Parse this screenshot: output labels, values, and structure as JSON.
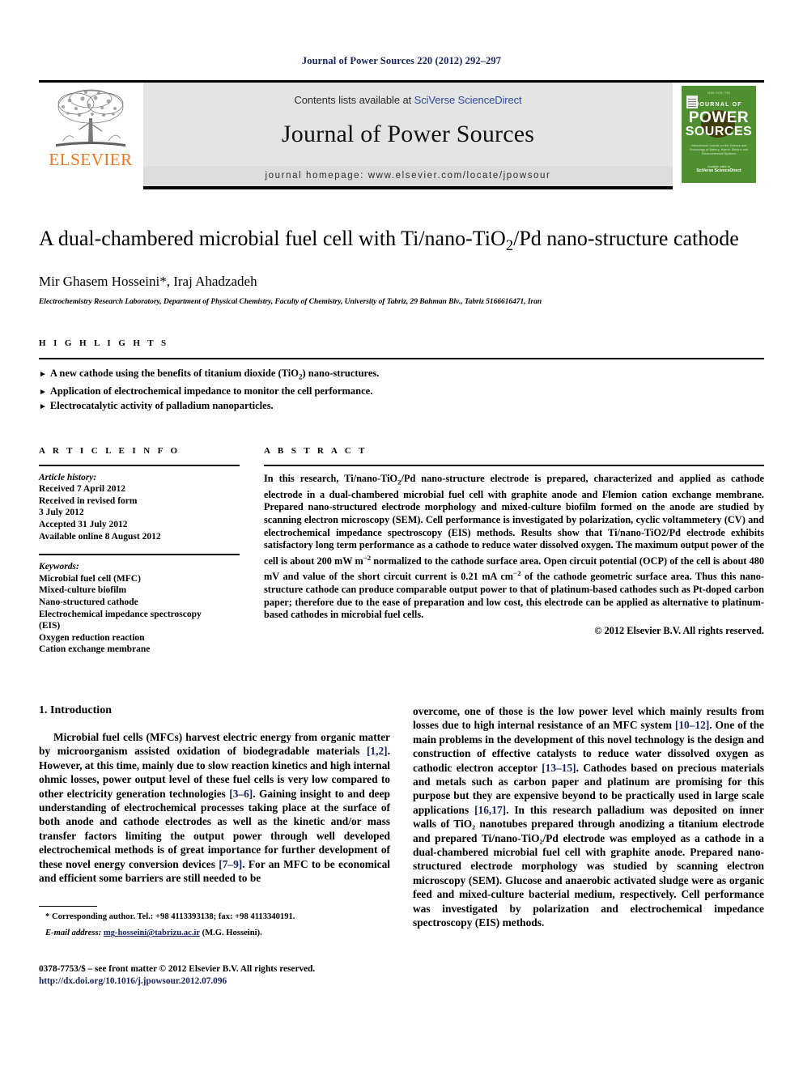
{
  "running_head": "Journal of Power Sources 220 (2012) 292–297",
  "masthead": {
    "publisher_name": "ELSEVIER",
    "contents_prefix": "Contents lists available at ",
    "contents_link": "SciVerse ScienceDirect",
    "journal_name": "Journal of Power Sources",
    "homepage": "journal homepage: www.elsevier.com/locate/jpowsour",
    "cover": {
      "topline": "ISSN 0378-7753",
      "journal_of": "JOURNAL OF",
      "power": "POWER",
      "sources": "SOURCES",
      "subtitle": "International Journal on the Science and Technology of Battery, Hybrid, Electric and Electrochemical Systems",
      "foot_small": "Available online at",
      "foot_big": "SciVerse ScienceDirect"
    }
  },
  "article": {
    "title": "A dual-chambered microbial fuel cell with Ti/nano-TiO₂/Pd nano-structure cathode",
    "authors": "Mir Ghasem Hosseini*, Iraj Ahadzadeh",
    "affiliation": "Electrochemistry Research Laboratory, Department of Physical Chemistry, Faculty of Chemistry, University of Tabriz, 29 Bahman Blv., Tabriz 5166616471, Iran"
  },
  "highlights": {
    "heading": "H I G H L I G H T S",
    "items": [
      "A new cathode using the benefits of titanium dioxide (TiO₂) nano-structures.",
      "Application of electrochemical impedance to monitor the cell performance.",
      "Electrocatalytic activity of palladium nanoparticles."
    ]
  },
  "article_info": {
    "heading": "A R T I C L E   I N F O",
    "history_label": "Article history:",
    "history": [
      "Received 7 April 2012",
      "Received in revised form",
      "3 July 2012",
      "Accepted 31 July 2012",
      "Available online 8 August 2012"
    ],
    "keywords_label": "Keywords:",
    "keywords": [
      "Microbial fuel cell (MFC)",
      "Mixed-culture biofilm",
      "Nano-structured cathode",
      "Electrochemical impedance spectroscopy",
      "(EIS)",
      "Oxygen reduction reaction",
      "Cation exchange membrane"
    ]
  },
  "abstract": {
    "heading": "A B S T R A C T",
    "text": "In this research, Ti/nano-TiO₂/Pd nano-structure electrode is prepared, characterized and applied as cathode electrode in a dual-chambered microbial fuel cell with graphite anode and Flemion cation exchange membrane. Prepared nano-structured electrode morphology and mixed-culture biofilm formed on the anode are studied by scanning electron microscopy (SEM). Cell performance is investigated by polarization, cyclic voltammetery (CV) and electrochemical impedance spectroscopy (EIS) methods. Results show that Ti/nano-TiO2/Pd electrode exhibits satisfactory long term performance as a cathode to reduce water dissolved oxygen. The maximum output power of the cell is about 200 mW m⁻² normalized to the cathode surface area. Open circuit potential (OCP) of the cell is about 480 mV and value of the short circuit current is 0.21 mA cm⁻² of the cathode geometric surface area. Thus this nano-structure cathode can produce comparable output power to that of platinum-based cathodes such as Pt-doped carbon paper; therefore due to the ease of preparation and low cost, this electrode can be applied as alternative to platinum-based cathodes in microbial fuel cells.",
    "copyright": "© 2012 Elsevier B.V. All rights reserved."
  },
  "introduction": {
    "heading": "1.  Introduction",
    "left_paragraph_part1": "Microbial fuel cells (MFCs) harvest electric energy from organic matter by microorganism assisted oxidation of biodegradable materials ",
    "left_ref1": "[1,2]",
    "left_paragraph_part2": ". However, at this time, mainly due to slow reaction kinetics and high internal ohmic losses, power output level of these fuel cells is very low compared to other electricity generation technologies ",
    "left_ref2": "[3–6]",
    "left_paragraph_part3": ". Gaining insight to and deep understanding of electrochemical processes taking place at the surface of both anode and cathode electrodes as well as the kinetic and/or mass transfer factors limiting the output power through well developed electrochemical methods is of great importance for further development of these novel energy conversion devices ",
    "left_ref3": "[7–9]",
    "left_paragraph_part4": ". For an MFC to be economical and efficient some barriers are still needed to be",
    "right_part1": "overcome, one of those is the low power level which mainly results from losses due to high internal resistance of an MFC system ",
    "right_ref1": "[10–12]",
    "right_part2": ". One of the main problems in the development of this novel technology is the design and construction of effective catalysts to reduce water dissolved oxygen as cathodic electron acceptor ",
    "right_ref2": "[13–15]",
    "right_part3": ". Cathodes based on precious materials and metals such as carbon paper and platinum are promising for this purpose but they are expensive beyond to be practically used in large scale applications ",
    "right_ref3": "[16,17]",
    "right_part4": ". In this research palladium was deposited on inner walls of TiO₂ nanotubes prepared through anodizing a titanium electrode and prepared Ti/nano-TiO₂/Pd electrode was employed as a cathode in a dual-chambered microbial fuel cell with graphite anode. Prepared nano-structured electrode morphology was studied by scanning electron microscopy (SEM). Glucose and anaerobic activated sludge were as organic feed and mixed-culture bacterial medium, respectively. Cell performance was investigated by polarization and electrochemical impedance spectroscopy (EIS) methods."
  },
  "footnote": {
    "corresponding": "* Corresponding author. Tel.: +98 4113393138; fax: +98 4113340191.",
    "email_label": "E-mail address:",
    "email": "mg-hosseini@tabrizu.ac.ir",
    "email_suffix": "(M.G. Hosseini).",
    "issn": "0378-7753/$ – see front matter © 2012 Elsevier B.V. All rights reserved.",
    "doi": "http://dx.doi.org/10.1016/j.jpowsour.2012.07.096"
  }
}
